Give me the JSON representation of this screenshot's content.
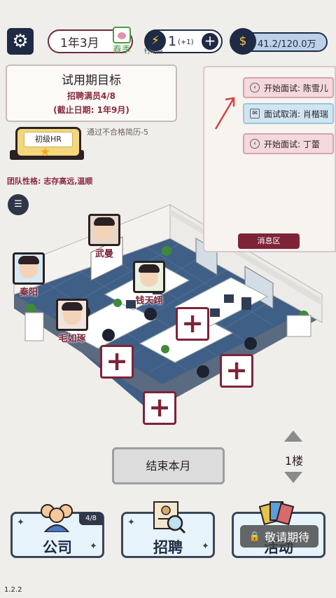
{
  "header": {
    "date": "1年3月",
    "season": "春季",
    "action_points": "1",
    "action_points_delta": "(+1)",
    "action_points_label": "行动点",
    "money": "41.2/120.0万"
  },
  "goal": {
    "title": "试用期目标",
    "requirement": "招聘满员4/8",
    "deadline": "(截止日期: 1年9月)"
  },
  "rank": {
    "label": "初级HR",
    "hint": "通过不合格简历-5"
  },
  "team_trait": "团队性格: 志存高远,温顺",
  "messages": {
    "items": [
      {
        "text": "开始面试: 陈雪儿",
        "type": "start"
      },
      {
        "text": "面试取消: 肖楷瑞",
        "type": "cancel"
      },
      {
        "text": "开始面试: 丁蕾",
        "type": "start"
      }
    ],
    "zone_label": "消息区"
  },
  "employees": [
    {
      "name": "武曼"
    },
    {
      "name": "秦阳"
    },
    {
      "name": "钱天翊"
    },
    {
      "name": "毛如琢"
    }
  ],
  "end_month_label": "结束本月",
  "floor_label": "1楼",
  "bottom": {
    "company_label": "公司",
    "company_count": "4/8",
    "recruit_label": "招聘",
    "activity_label": "活动",
    "locked_label": "敬请期待"
  },
  "version": "1.2.2",
  "colors": {
    "accent": "#7d2438",
    "navy": "#1f2a44",
    "background": "#efeeea"
  }
}
